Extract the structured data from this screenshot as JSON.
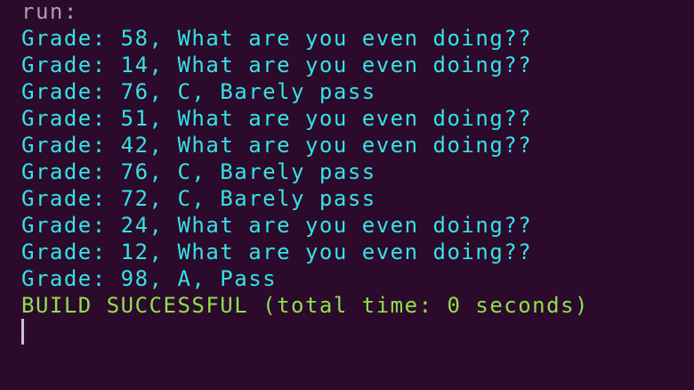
{
  "terminal": {
    "run_label": "run:",
    "output_lines": [
      "Grade: 58, What are you even doing??",
      "Grade: 14, What are you even doing??",
      "Grade: 76, C, Barely pass",
      "Grade: 51, What are you even doing??",
      "Grade: 42, What are you even doing??",
      "Grade: 76, C, Barely pass",
      "Grade: 72, C, Barely pass",
      "Grade: 24, What are you even doing??",
      "Grade: 12, What are you even doing??",
      "Grade: 98, A, Pass"
    ],
    "build_status": "BUILD SUCCESSFUL (total time: 0 seconds)"
  },
  "colors": {
    "background": "#2c0a2b",
    "run_text": "#a8a3a8",
    "output_text": "#33e3e6",
    "build_text": "#8ee04c",
    "cursor": "#c9c4c9"
  }
}
